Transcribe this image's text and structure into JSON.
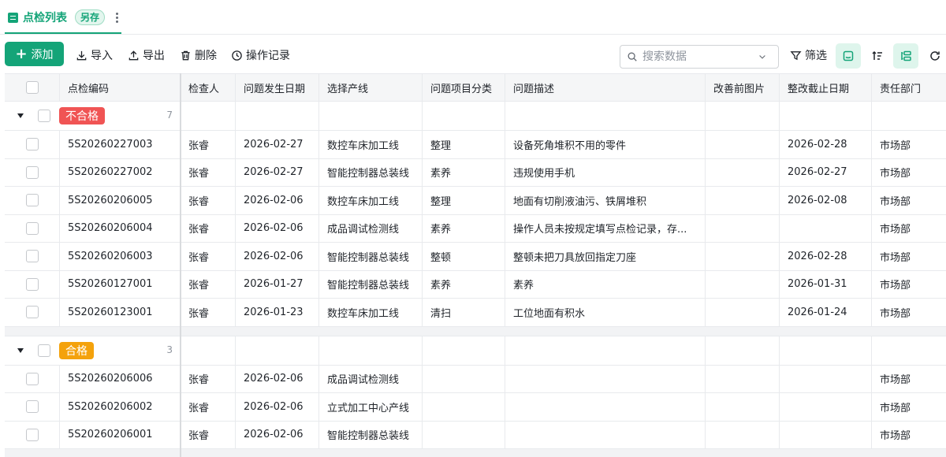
{
  "tab": {
    "title": "点检列表",
    "save_as": "另存"
  },
  "toolbar": {
    "add": "添加",
    "import": "导入",
    "export": "导出",
    "delete": "删除",
    "history": "操作记录",
    "search_placeholder": "搜索数据",
    "filter": "筛选"
  },
  "columns": [
    "点检编码",
    "检查人",
    "问题发生日期",
    "选择产线",
    "问题项目分类",
    "问题描述",
    "改善前图片",
    "整改截止日期",
    "责任部门"
  ],
  "groups": [
    {
      "label": "不合格",
      "color": "#f05454",
      "count": "7",
      "rows": [
        {
          "code": "5S20260227003",
          "inspector": "张睿",
          "date": "2026-02-27",
          "line": "数控车床加工线",
          "category": "整理",
          "desc": "设备死角堆积不用的零件",
          "image": "",
          "deadline": "2026-02-28",
          "dept": "市场部"
        },
        {
          "code": "5S20260227002",
          "inspector": "张睿",
          "date": "2026-02-27",
          "line": "智能控制器总装线",
          "category": "素养",
          "desc": "违规使用手机",
          "image": "",
          "deadline": "2026-02-27",
          "dept": "市场部"
        },
        {
          "code": "5S20260206005",
          "inspector": "张睿",
          "date": "2026-02-06",
          "line": "数控车床加工线",
          "category": "整理",
          "desc": "地面有切削液油污、铁屑堆积",
          "image": "",
          "deadline": "2026-02-08",
          "dept": "市场部"
        },
        {
          "code": "5S20260206004",
          "inspector": "张睿",
          "date": "2026-02-06",
          "line": "成品调试检测线",
          "category": "素养",
          "desc": "操作人员未按规定填写点检记录，存...",
          "image": "",
          "deadline": "",
          "dept": "市场部"
        },
        {
          "code": "5S20260206003",
          "inspector": "张睿",
          "date": "2026-02-06",
          "line": "智能控制器总装线",
          "category": "整顿",
          "desc": "整顿未把刀具放回指定刀座",
          "image": "",
          "deadline": "2026-02-28",
          "dept": "市场部"
        },
        {
          "code": "5S20260127001",
          "inspector": "张睿",
          "date": "2026-01-27",
          "line": "智能控制器总装线",
          "category": "素养",
          "desc": "素养",
          "image": "",
          "deadline": "2026-01-31",
          "dept": "市场部"
        },
        {
          "code": "5S20260123001",
          "inspector": "张睿",
          "date": "2026-01-23",
          "line": "数控车床加工线",
          "category": "清扫",
          "desc": "工位地面有积水",
          "image": "",
          "deadline": "2026-01-24",
          "dept": "市场部"
        }
      ]
    },
    {
      "label": "合格",
      "color": "#f4a20c",
      "count": "3",
      "rows": [
        {
          "code": "5S20260206006",
          "inspector": "张睿",
          "date": "2026-02-06",
          "line": "成品调试检测线",
          "category": "",
          "desc": "",
          "image": "",
          "deadline": "",
          "dept": "市场部"
        },
        {
          "code": "5S20260206002",
          "inspector": "张睿",
          "date": "2026-02-06",
          "line": "立式加工中心产线",
          "category": "",
          "desc": "",
          "image": "",
          "deadline": "",
          "dept": "市场部"
        },
        {
          "code": "5S20260206001",
          "inspector": "张睿",
          "date": "2026-02-06",
          "line": "智能控制器总装线",
          "category": "",
          "desc": "",
          "image": "",
          "deadline": "",
          "dept": "市场部"
        }
      ]
    }
  ],
  "icons": {
    "tab": "table-list-icon",
    "more": "more-vertical-icon",
    "add": "plus-icon",
    "import": "download-icon",
    "export": "upload-icon",
    "delete": "trash-icon",
    "history": "clock-icon",
    "search": "search-icon",
    "dropdown": "chevron-down-icon",
    "filter": "funnel-icon",
    "sort": "sort-icon",
    "group": "group-icon",
    "refresh": "refresh-icon",
    "collapse": "caret-down-icon"
  },
  "colors": {
    "accent": "#14a478",
    "fail": "#f05454",
    "pass": "#f4a20c"
  }
}
